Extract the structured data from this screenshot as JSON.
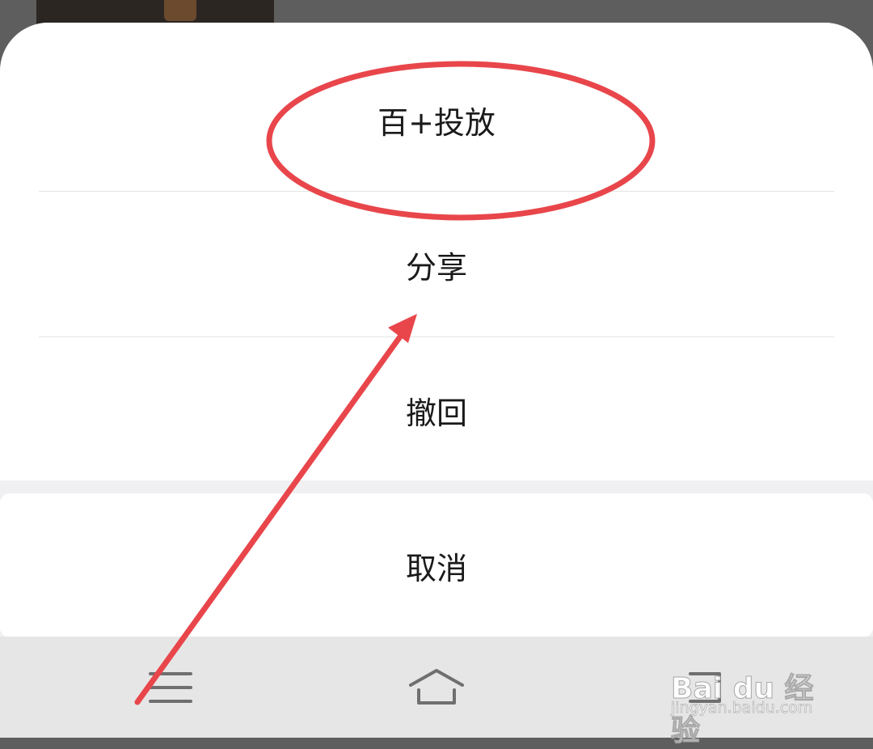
{
  "action_sheet": {
    "items": [
      {
        "label": "百+投放"
      },
      {
        "label": "分享"
      },
      {
        "label": "撤回"
      }
    ],
    "cancel_label": "取消"
  },
  "nav_bar": {
    "buttons": [
      {
        "icon": "menu-icon"
      },
      {
        "icon": "home-icon"
      },
      {
        "icon": "back-icon"
      }
    ]
  },
  "annotation": {
    "color": "#e8464b",
    "highlighted_item": "百+投放"
  },
  "watermark": {
    "logo_text": "Bai du 经验",
    "url": "jingyan.baidu.com"
  }
}
